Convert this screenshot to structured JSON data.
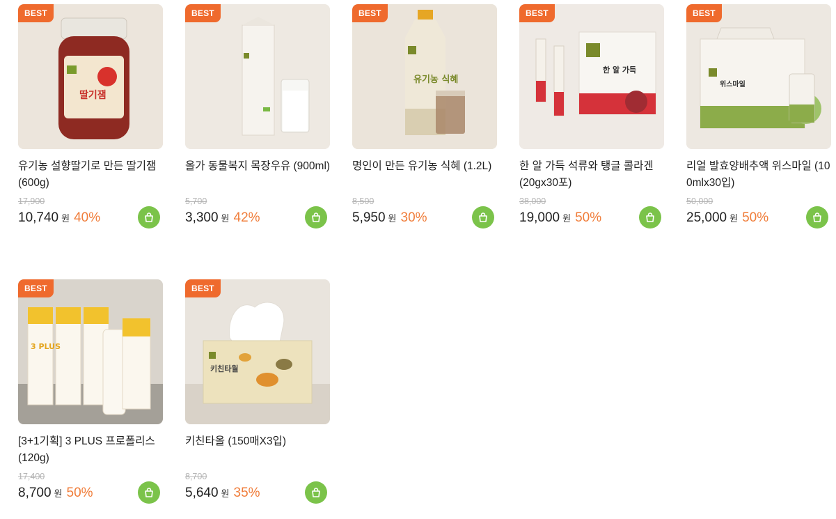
{
  "badge_label": "BEST",
  "currency_label": "원",
  "colors": {
    "badge": "#ef6a2d",
    "discount": "#f07d3a",
    "cart_button": "#7bc34a"
  },
  "products": [
    {
      "name": "유기농 설향딸기로 만든 딸기잼 (600g)",
      "original_price": "17,900",
      "price": "10,740",
      "discount": "40%",
      "image_icon": "strawberry-jam-jar",
      "image_label": "딸기잼"
    },
    {
      "name": "올가 동물복지 목장우유 (900ml)",
      "original_price": "5,700",
      "price": "3,300",
      "discount": "42%",
      "image_icon": "milk-carton-and-glass",
      "image_label": ""
    },
    {
      "name": "명인이 만든 유기농 식혜 (1.2L)",
      "original_price": "8,500",
      "price": "5,950",
      "discount": "30%",
      "image_icon": "sikhye-bottle-and-glass",
      "image_label": "유기농 식혜"
    },
    {
      "name": "한 알 가득 석류와 탱글 콜라겐 (20gx30포)",
      "original_price": "38,000",
      "price": "19,000",
      "discount": "50%",
      "image_icon": "collagen-box-and-sticks",
      "image_label": "한 알 가득"
    },
    {
      "name": "리얼 발효양배추액 위스마일 (100mlx30입)",
      "original_price": "50,000",
      "price": "25,000",
      "discount": "50%",
      "image_icon": "cabbage-juice-gift-box",
      "image_label": "위스마일"
    },
    {
      "name": "[3+1기획] 3 PLUS 프로폴리스 (120g)",
      "original_price": "17,400",
      "price": "8,700",
      "discount": "50%",
      "image_icon": "propolis-toothpaste-boxes",
      "image_label": "3 PLUS"
    },
    {
      "name": "키친타올 (150매X3입)",
      "original_price": "8,700",
      "price": "5,640",
      "discount": "35%",
      "image_icon": "kitchen-towel-box",
      "image_label": "키친타월"
    }
  ]
}
